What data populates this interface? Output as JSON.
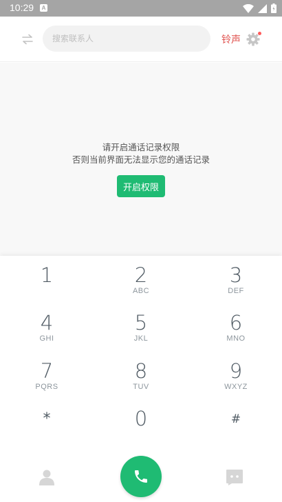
{
  "status_bar": {
    "time": "10:29",
    "notif_badge": "A"
  },
  "top_bar": {
    "search_placeholder": "搜索联系人",
    "ringtone_label": "铃声"
  },
  "permission": {
    "line1": "请开启通话记录权限",
    "line2": "否则当前界面无法显示您的通话记录",
    "button_label": "开启权限"
  },
  "dialpad": {
    "keys": [
      {
        "digit": "1",
        "letters": ""
      },
      {
        "digit": "2",
        "letters": "ABC"
      },
      {
        "digit": "3",
        "letters": "DEF"
      },
      {
        "digit": "4",
        "letters": "GHI"
      },
      {
        "digit": "5",
        "letters": "JKL"
      },
      {
        "digit": "6",
        "letters": "MNO"
      },
      {
        "digit": "7",
        "letters": "PQRS"
      },
      {
        "digit": "8",
        "letters": "TUV"
      },
      {
        "digit": "9",
        "letters": "WXYZ"
      },
      {
        "digit": "*",
        "letters": ""
      },
      {
        "digit": "0",
        "letters": ""
      },
      {
        "digit": "#",
        "letters": ""
      }
    ]
  },
  "colors": {
    "accent_green": "#1fbb73",
    "accent_red": "#e0524e"
  },
  "icons": [
    "swap-icon",
    "gear-icon",
    "contacts-icon",
    "phone-icon",
    "message-icon",
    "wifi-icon",
    "signal-icon",
    "battery-icon"
  ]
}
